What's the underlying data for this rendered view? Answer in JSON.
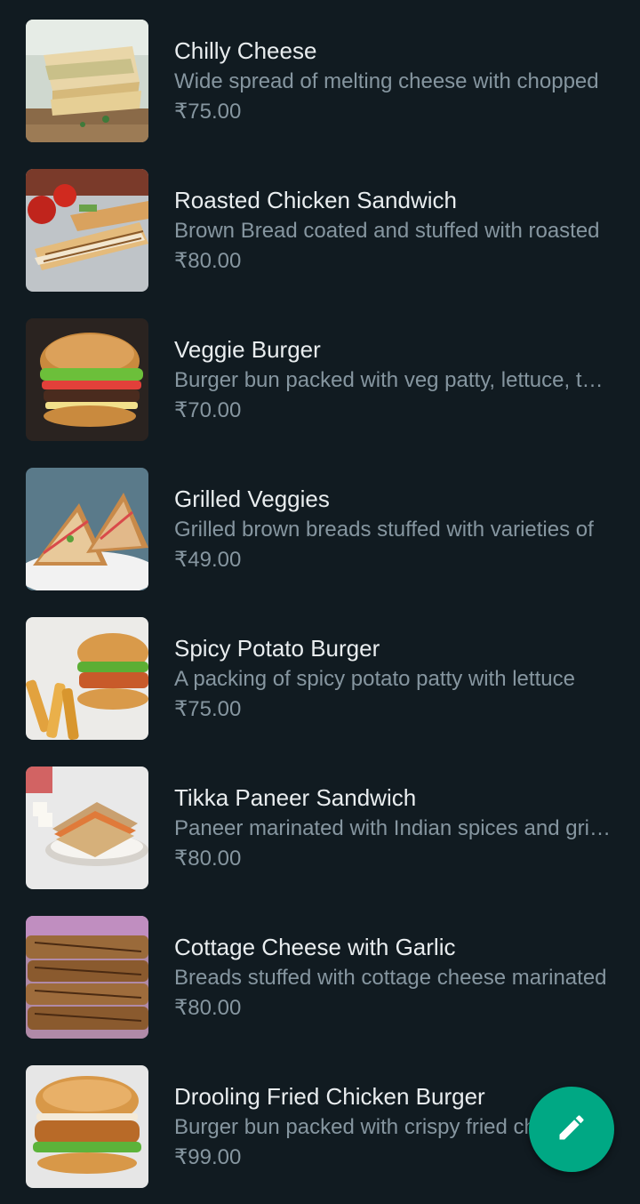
{
  "menu": {
    "items": [
      {
        "name": "Chilly Cheese",
        "description": "Wide spread of melting cheese with chopped",
        "price": "₹75.00",
        "image": "grilled-cheese-sandwich"
      },
      {
        "name": "Roasted Chicken Sandwich",
        "description": "Brown Bread coated and stuffed with roasted",
        "price": "₹80.00",
        "image": "chicken-sandwich"
      },
      {
        "name": "Veggie Burger",
        "description": "Burger bun packed with veg patty, lettuce, tomato",
        "price": "₹70.00",
        "image": "veggie-burger"
      },
      {
        "name": "Grilled Veggies",
        "description": "Grilled brown breads stuffed with varieties of",
        "price": "₹49.00",
        "image": "grilled-veggie-sandwich"
      },
      {
        "name": "Spicy Potato Burger",
        "description": "A packing of spicy potato patty with lettuce",
        "price": "₹75.00",
        "image": "potato-burger-fries"
      },
      {
        "name": "Tikka Paneer Sandwich",
        "description": "Paneer marinated with Indian spices and grilled",
        "price": "₹80.00",
        "image": "paneer-sandwich"
      },
      {
        "name": "Cottage Cheese with Garlic",
        "description": "Breads stuffed with cottage cheese marinated",
        "price": "₹80.00",
        "image": "stacked-grilled-sandwich"
      },
      {
        "name": "Drooling Fried Chicken Burger",
        "description": "Burger bun packed with crispy fried chicken",
        "price": "₹99.00",
        "image": "fried-chicken-burger"
      }
    ]
  },
  "fab": {
    "icon": "pencil-icon",
    "color": "#00a884"
  },
  "colors": {
    "background": "#111b21",
    "title": "#e9edef",
    "secondary": "#8696a0"
  }
}
